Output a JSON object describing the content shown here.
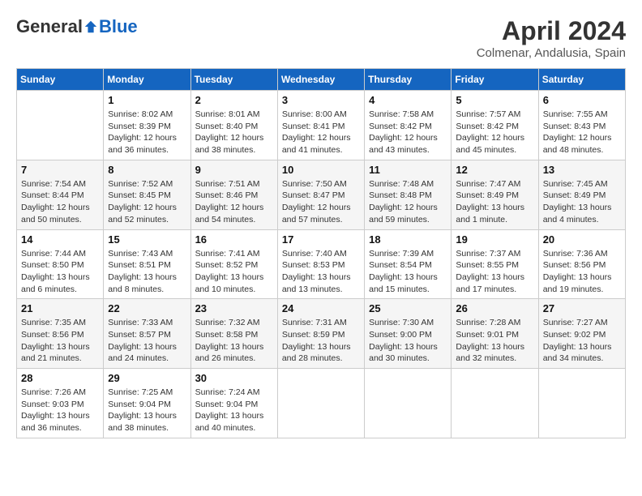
{
  "header": {
    "logo_general": "General",
    "logo_blue": "Blue",
    "month": "April 2024",
    "location": "Colmenar, Andalusia, Spain"
  },
  "days_of_week": [
    "Sunday",
    "Monday",
    "Tuesday",
    "Wednesday",
    "Thursday",
    "Friday",
    "Saturday"
  ],
  "weeks": [
    [
      {
        "day": "",
        "empty": true
      },
      {
        "day": "1",
        "sunrise": "Sunrise: 8:02 AM",
        "sunset": "Sunset: 8:39 PM",
        "daylight": "Daylight: 12 hours and 36 minutes."
      },
      {
        "day": "2",
        "sunrise": "Sunrise: 8:01 AM",
        "sunset": "Sunset: 8:40 PM",
        "daylight": "Daylight: 12 hours and 38 minutes."
      },
      {
        "day": "3",
        "sunrise": "Sunrise: 8:00 AM",
        "sunset": "Sunset: 8:41 PM",
        "daylight": "Daylight: 12 hours and 41 minutes."
      },
      {
        "day": "4",
        "sunrise": "Sunrise: 7:58 AM",
        "sunset": "Sunset: 8:42 PM",
        "daylight": "Daylight: 12 hours and 43 minutes."
      },
      {
        "day": "5",
        "sunrise": "Sunrise: 7:57 AM",
        "sunset": "Sunset: 8:42 PM",
        "daylight": "Daylight: 12 hours and 45 minutes."
      },
      {
        "day": "6",
        "sunrise": "Sunrise: 7:55 AM",
        "sunset": "Sunset: 8:43 PM",
        "daylight": "Daylight: 12 hours and 48 minutes."
      }
    ],
    [
      {
        "day": "7",
        "sunrise": "Sunrise: 7:54 AM",
        "sunset": "Sunset: 8:44 PM",
        "daylight": "Daylight: 12 hours and 50 minutes."
      },
      {
        "day": "8",
        "sunrise": "Sunrise: 7:52 AM",
        "sunset": "Sunset: 8:45 PM",
        "daylight": "Daylight: 12 hours and 52 minutes."
      },
      {
        "day": "9",
        "sunrise": "Sunrise: 7:51 AM",
        "sunset": "Sunset: 8:46 PM",
        "daylight": "Daylight: 12 hours and 54 minutes."
      },
      {
        "day": "10",
        "sunrise": "Sunrise: 7:50 AM",
        "sunset": "Sunset: 8:47 PM",
        "daylight": "Daylight: 12 hours and 57 minutes."
      },
      {
        "day": "11",
        "sunrise": "Sunrise: 7:48 AM",
        "sunset": "Sunset: 8:48 PM",
        "daylight": "Daylight: 12 hours and 59 minutes."
      },
      {
        "day": "12",
        "sunrise": "Sunrise: 7:47 AM",
        "sunset": "Sunset: 8:49 PM",
        "daylight": "Daylight: 13 hours and 1 minute."
      },
      {
        "day": "13",
        "sunrise": "Sunrise: 7:45 AM",
        "sunset": "Sunset: 8:49 PM",
        "daylight": "Daylight: 13 hours and 4 minutes."
      }
    ],
    [
      {
        "day": "14",
        "sunrise": "Sunrise: 7:44 AM",
        "sunset": "Sunset: 8:50 PM",
        "daylight": "Daylight: 13 hours and 6 minutes."
      },
      {
        "day": "15",
        "sunrise": "Sunrise: 7:43 AM",
        "sunset": "Sunset: 8:51 PM",
        "daylight": "Daylight: 13 hours and 8 minutes."
      },
      {
        "day": "16",
        "sunrise": "Sunrise: 7:41 AM",
        "sunset": "Sunset: 8:52 PM",
        "daylight": "Daylight: 13 hours and 10 minutes."
      },
      {
        "day": "17",
        "sunrise": "Sunrise: 7:40 AM",
        "sunset": "Sunset: 8:53 PM",
        "daylight": "Daylight: 13 hours and 13 minutes."
      },
      {
        "day": "18",
        "sunrise": "Sunrise: 7:39 AM",
        "sunset": "Sunset: 8:54 PM",
        "daylight": "Daylight: 13 hours and 15 minutes."
      },
      {
        "day": "19",
        "sunrise": "Sunrise: 7:37 AM",
        "sunset": "Sunset: 8:55 PM",
        "daylight": "Daylight: 13 hours and 17 minutes."
      },
      {
        "day": "20",
        "sunrise": "Sunrise: 7:36 AM",
        "sunset": "Sunset: 8:56 PM",
        "daylight": "Daylight: 13 hours and 19 minutes."
      }
    ],
    [
      {
        "day": "21",
        "sunrise": "Sunrise: 7:35 AM",
        "sunset": "Sunset: 8:56 PM",
        "daylight": "Daylight: 13 hours and 21 minutes."
      },
      {
        "day": "22",
        "sunrise": "Sunrise: 7:33 AM",
        "sunset": "Sunset: 8:57 PM",
        "daylight": "Daylight: 13 hours and 24 minutes."
      },
      {
        "day": "23",
        "sunrise": "Sunrise: 7:32 AM",
        "sunset": "Sunset: 8:58 PM",
        "daylight": "Daylight: 13 hours and 26 minutes."
      },
      {
        "day": "24",
        "sunrise": "Sunrise: 7:31 AM",
        "sunset": "Sunset: 8:59 PM",
        "daylight": "Daylight: 13 hours and 28 minutes."
      },
      {
        "day": "25",
        "sunrise": "Sunrise: 7:30 AM",
        "sunset": "Sunset: 9:00 PM",
        "daylight": "Daylight: 13 hours and 30 minutes."
      },
      {
        "day": "26",
        "sunrise": "Sunrise: 7:28 AM",
        "sunset": "Sunset: 9:01 PM",
        "daylight": "Daylight: 13 hours and 32 minutes."
      },
      {
        "day": "27",
        "sunrise": "Sunrise: 7:27 AM",
        "sunset": "Sunset: 9:02 PM",
        "daylight": "Daylight: 13 hours and 34 minutes."
      }
    ],
    [
      {
        "day": "28",
        "sunrise": "Sunrise: 7:26 AM",
        "sunset": "Sunset: 9:03 PM",
        "daylight": "Daylight: 13 hours and 36 minutes."
      },
      {
        "day": "29",
        "sunrise": "Sunrise: 7:25 AM",
        "sunset": "Sunset: 9:04 PM",
        "daylight": "Daylight: 13 hours and 38 minutes."
      },
      {
        "day": "30",
        "sunrise": "Sunrise: 7:24 AM",
        "sunset": "Sunset: 9:04 PM",
        "daylight": "Daylight: 13 hours and 40 minutes."
      },
      {
        "day": "",
        "empty": true
      },
      {
        "day": "",
        "empty": true
      },
      {
        "day": "",
        "empty": true
      },
      {
        "day": "",
        "empty": true
      }
    ]
  ]
}
